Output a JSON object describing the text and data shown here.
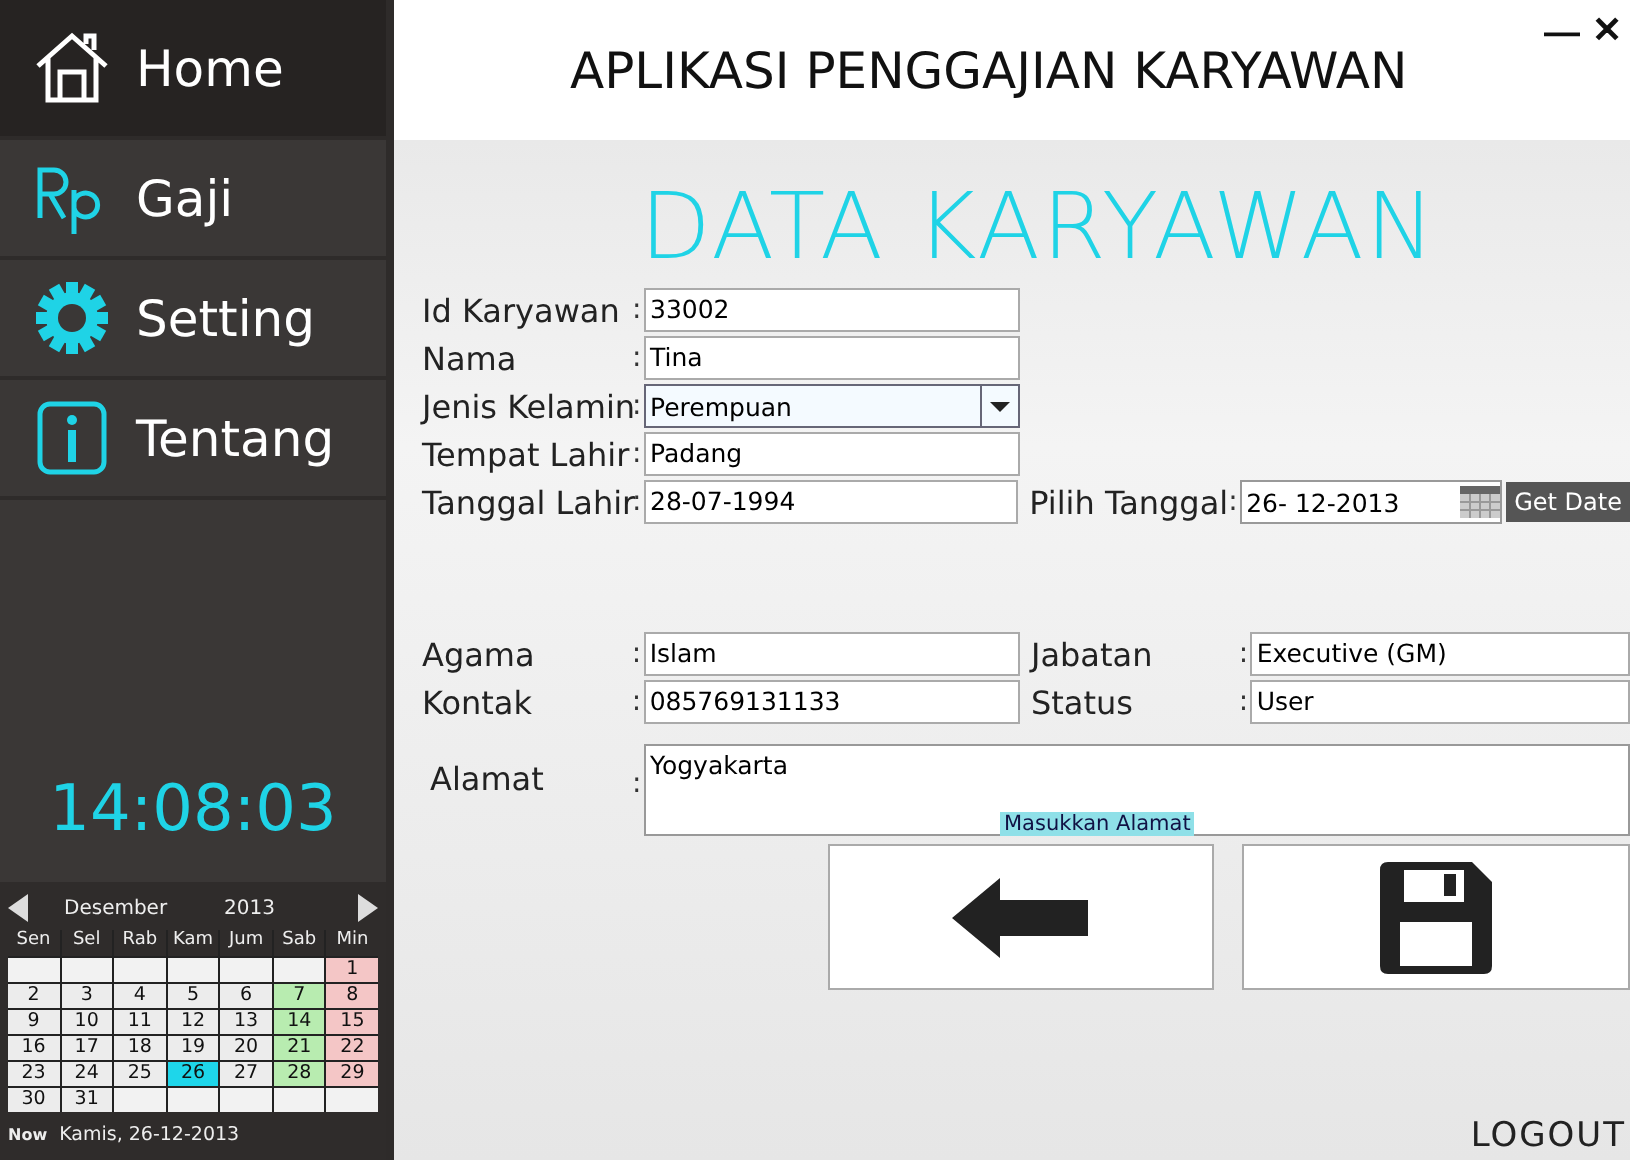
{
  "window": {
    "title": "APLIKASI PENGGAJIAN KARYAWAN",
    "controls": [
      {
        "kind": "minimize",
        "label": "—"
      },
      {
        "kind": "close",
        "label": "✕"
      }
    ]
  },
  "menu": [
    {
      "kind": "home",
      "label": "Home",
      "selected": true
    },
    {
      "kind": "salary",
      "label": "Gaji",
      "selected": false
    },
    {
      "kind": "settings",
      "label": "Setting",
      "selected": false
    },
    {
      "kind": "about",
      "label": "Tentang",
      "selected": false
    }
  ],
  "clock": "14:08:03",
  "calendar": {
    "month": "Desember",
    "year": "2013",
    "weekdays": [
      "Sen",
      "Sel",
      "Rab",
      "Kam",
      "Jum",
      "Sab",
      "Min"
    ],
    "weeks": [
      [
        {
          "kind": "blank"
        },
        {
          "kind": "blank"
        },
        {
          "kind": "blank"
        },
        {
          "kind": "blank"
        },
        {
          "kind": "blank"
        },
        {
          "kind": "blank"
        },
        {
          "kind": "day",
          "day": "1",
          "color": "#f4c6c6"
        }
      ],
      [
        {
          "kind": "day",
          "day": "2",
          "color": "#ececec"
        },
        {
          "kind": "day",
          "day": "3",
          "color": "#ececec"
        },
        {
          "kind": "day",
          "day": "4",
          "color": "#ececec"
        },
        {
          "kind": "day",
          "day": "5",
          "color": "#ececec"
        },
        {
          "kind": "day",
          "day": "6",
          "color": "#ececec"
        },
        {
          "kind": "day",
          "day": "7",
          "color": "#b8ecb0"
        },
        {
          "kind": "day",
          "day": "8",
          "color": "#f4c6c6"
        }
      ],
      [
        {
          "kind": "day",
          "day": "9",
          "color": "#ececec"
        },
        {
          "kind": "day",
          "day": "10",
          "color": "#ececec"
        },
        {
          "kind": "day",
          "day": "11",
          "color": "#ececec"
        },
        {
          "kind": "day",
          "day": "12",
          "color": "#ececec"
        },
        {
          "kind": "day",
          "day": "13",
          "color": "#ececec"
        },
        {
          "kind": "day",
          "day": "14",
          "color": "#b8ecb0"
        },
        {
          "kind": "day",
          "day": "15",
          "color": "#f4c6c6"
        }
      ],
      [
        {
          "kind": "day",
          "day": "16",
          "color": "#ececec"
        },
        {
          "kind": "day",
          "day": "17",
          "color": "#ececec"
        },
        {
          "kind": "day",
          "day": "18",
          "color": "#ececec"
        },
        {
          "kind": "day",
          "day": "19",
          "color": "#ececec"
        },
        {
          "kind": "day",
          "day": "20",
          "color": "#ececec"
        },
        {
          "kind": "day",
          "day": "21",
          "color": "#b8ecb0"
        },
        {
          "kind": "day",
          "day": "22",
          "color": "#f4c6c6"
        }
      ],
      [
        {
          "kind": "day",
          "day": "23",
          "color": "#ececec"
        },
        {
          "kind": "day",
          "day": "24",
          "color": "#ececec"
        },
        {
          "kind": "day",
          "day": "25",
          "color": "#ececec"
        },
        {
          "kind": "day",
          "day": "26",
          "color": "#1ed6ea"
        },
        {
          "kind": "day",
          "day": "27",
          "color": "#ececec"
        },
        {
          "kind": "day",
          "day": "28",
          "color": "#b8ecb0"
        },
        {
          "kind": "day",
          "day": "29",
          "color": "#f4c6c6"
        }
      ],
      [
        {
          "kind": "day",
          "day": "30",
          "color": "#ececec"
        },
        {
          "kind": "day",
          "day": "31",
          "color": "#ececec"
        },
        {
          "kind": "blank"
        },
        {
          "kind": "blank"
        },
        {
          "kind": "blank"
        },
        {
          "kind": "blank"
        },
        {
          "kind": "blank"
        }
      ]
    ],
    "now_label": "Now",
    "now_value": "Kamis, 26-12-2013"
  },
  "heading": "DATA KARYAWAN",
  "fields_top": [
    {
      "kind": "text",
      "label": "Id Karyawan",
      "separator": ":",
      "value": "33002"
    },
    {
      "kind": "text",
      "label": "Nama",
      "separator": ":",
      "value": "Tina"
    },
    {
      "kind": "dropdown",
      "label": "Jenis Kelamin",
      "separator": ":",
      "value": "Perempuan"
    },
    {
      "kind": "text",
      "label": "Tempat Lahir",
      "separator": ":",
      "value": "Padang"
    },
    {
      "kind": "text",
      "label": "Tanggal Lahir",
      "separator": ":",
      "value": "28-07-1994"
    }
  ],
  "date_picker": {
    "label": "Pilih Tanggal",
    "separator": ":",
    "value": "26- 12-2013",
    "button": "Get Date"
  },
  "fields_left": [
    {
      "label": "Agama",
      "separator": ":",
      "value": "Islam"
    },
    {
      "label": "Kontak",
      "separator": ":",
      "value": "085769131133"
    }
  ],
  "fields_right": [
    {
      "label": "Jabatan",
      "separator": ":",
      "value": "Executive (GM)"
    },
    {
      "label": "Status",
      "separator": ":",
      "value": "User"
    }
  ],
  "address": {
    "label": "Alamat",
    "separator": ":",
    "value": "Yogyakarta",
    "tooltip": "Masukkan Alamat"
  },
  "actions": [
    {
      "kind": "back"
    },
    {
      "kind": "save"
    }
  ],
  "logout": "LOGOUT"
}
